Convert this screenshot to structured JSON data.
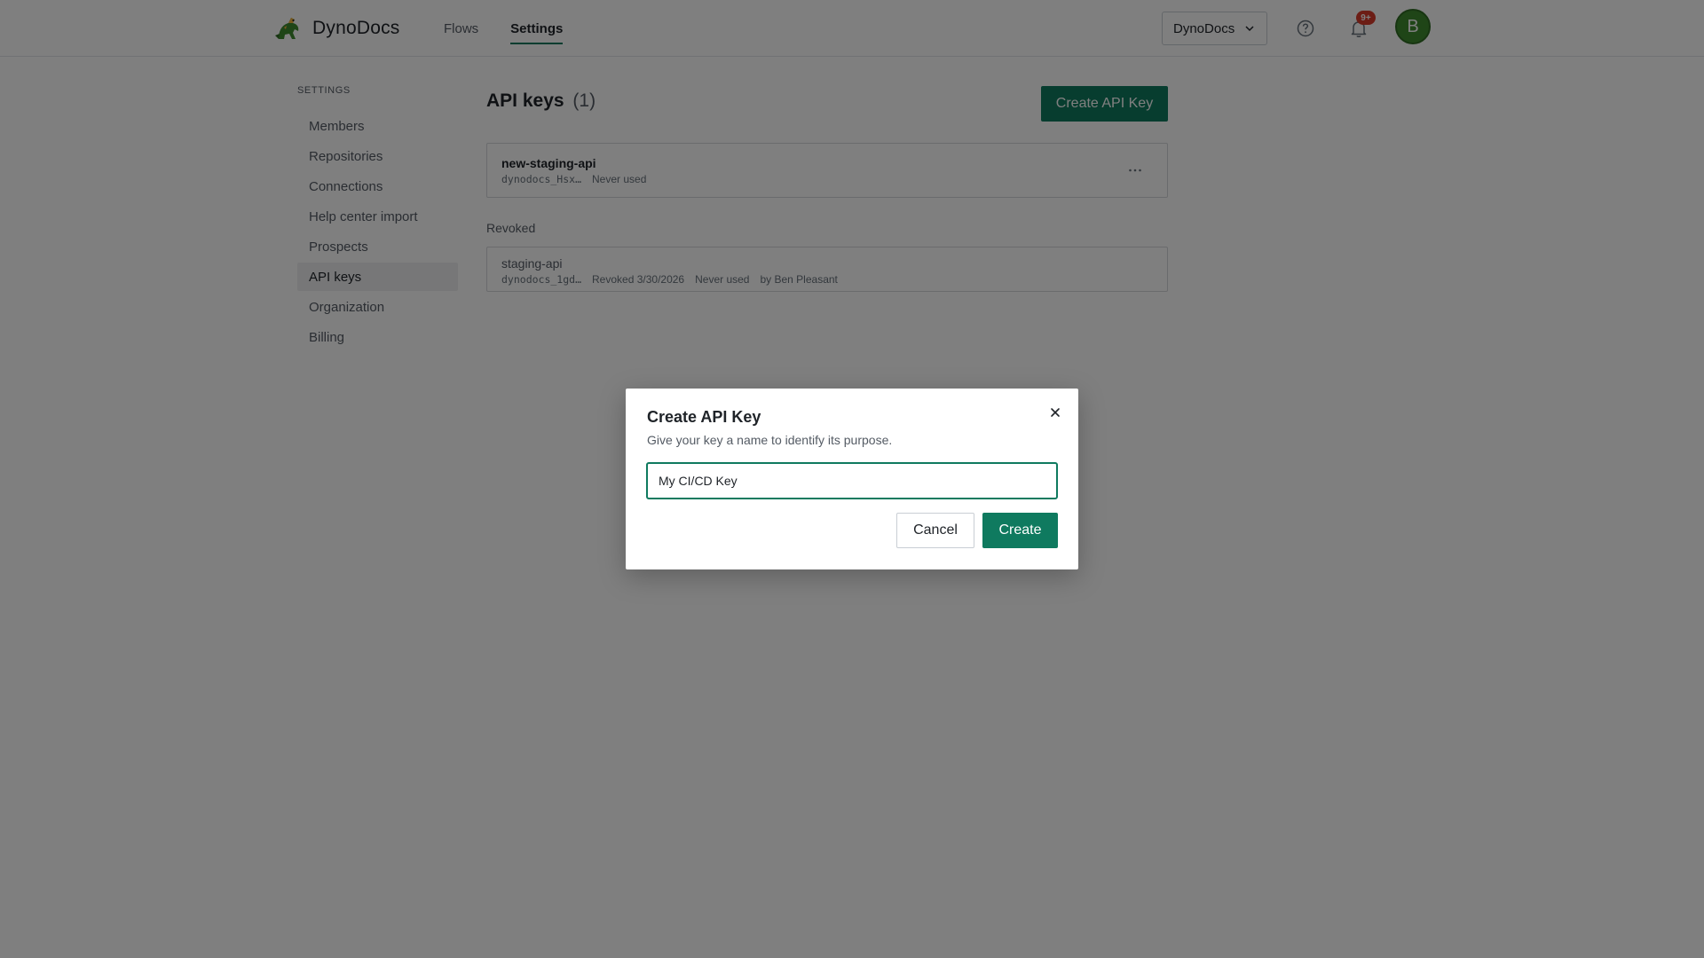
{
  "app": {
    "name": "DynoDocs"
  },
  "topbar": {
    "nav": [
      {
        "label": "Flows",
        "active": false
      },
      {
        "label": "Settings",
        "active": true
      }
    ],
    "org_selector": {
      "value": "DynoDocs"
    },
    "notifications": {
      "badge": "9+"
    },
    "avatar": {
      "initial": "B",
      "color": "#3f8a2f"
    }
  },
  "sidebar": {
    "heading": "SETTINGS",
    "items": [
      {
        "label": "Members",
        "active": false
      },
      {
        "label": "Repositories",
        "active": false
      },
      {
        "label": "Connections",
        "active": false
      },
      {
        "label": "Help center import",
        "active": false
      },
      {
        "label": "Prospects",
        "active": false
      },
      {
        "label": "API keys",
        "active": true
      },
      {
        "label": "Organization",
        "active": false
      },
      {
        "label": "Billing",
        "active": false
      }
    ]
  },
  "main": {
    "title": "API keys",
    "count": "(1)",
    "create_button": "Create API Key",
    "active_keys": [
      {
        "name": "new-staging-api",
        "token": "dynodocs_Hsx…",
        "last_used": "Never used"
      }
    ],
    "revoked_label": "Revoked",
    "revoked_keys": [
      {
        "name": "staging-api",
        "token": "dynodocs_1gd…",
        "revoked": "Revoked 3/30/2026",
        "last_used": "Never used",
        "by": "by Ben Pleasant"
      }
    ]
  },
  "modal": {
    "title": "Create API Key",
    "subtitle": "Give your key a name to identify its purpose.",
    "input_value": "My CI/CD Key",
    "cancel_label": "Cancel",
    "create_label": "Create"
  },
  "colors": {
    "accent": "#0f7a5f",
    "badge": "#d83b2b"
  }
}
